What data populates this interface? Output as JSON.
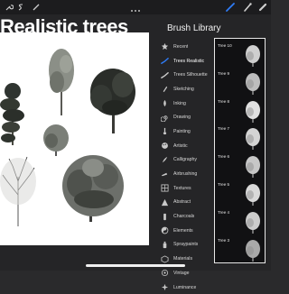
{
  "canvas": {
    "title": "Realistic trees"
  },
  "panel": {
    "title": "Brush Library",
    "categories": [
      {
        "label": "Recent",
        "icon": "star-icon"
      },
      {
        "label": "Trees Realistic",
        "icon": "brush-stroke-icon",
        "active": true
      },
      {
        "label": "Trees Silhouette",
        "icon": "brush-stroke-icon"
      },
      {
        "label": "Sketching",
        "icon": "pencil-icon"
      },
      {
        "label": "Inking",
        "icon": "ink-drop-icon"
      },
      {
        "label": "Drawing",
        "icon": "spiral-icon"
      },
      {
        "label": "Painting",
        "icon": "paintbrush-icon"
      },
      {
        "label": "Artistic",
        "icon": "palette-icon"
      },
      {
        "label": "Calligraphy",
        "icon": "quill-icon"
      },
      {
        "label": "Airbrushing",
        "icon": "airbrush-icon"
      },
      {
        "label": "Textures",
        "icon": "grid-icon"
      },
      {
        "label": "Abstract",
        "icon": "triangle-icon"
      },
      {
        "label": "Charcoals",
        "icon": "charcoal-icon"
      },
      {
        "label": "Elements",
        "icon": "yin-yang-icon"
      },
      {
        "label": "Spraypaints",
        "icon": "spray-can-icon"
      },
      {
        "label": "Materials",
        "icon": "cube-icon"
      },
      {
        "label": "Vintage",
        "icon": "vintage-icon"
      },
      {
        "label": "Luminance",
        "icon": "sparkle-icon"
      }
    ],
    "brushes": [
      {
        "name": "Tree 10"
      },
      {
        "name": "Tree 9"
      },
      {
        "name": "Tree 8"
      },
      {
        "name": "Tree 7"
      },
      {
        "name": "Tree 6"
      },
      {
        "name": "Tree 5"
      },
      {
        "name": "Tree 4"
      },
      {
        "name": "Tree 3"
      }
    ]
  },
  "colors": {
    "accent": "#2f7bf5",
    "panel_bg": "#252527",
    "toolbar_bg": "#1c1c1e"
  }
}
